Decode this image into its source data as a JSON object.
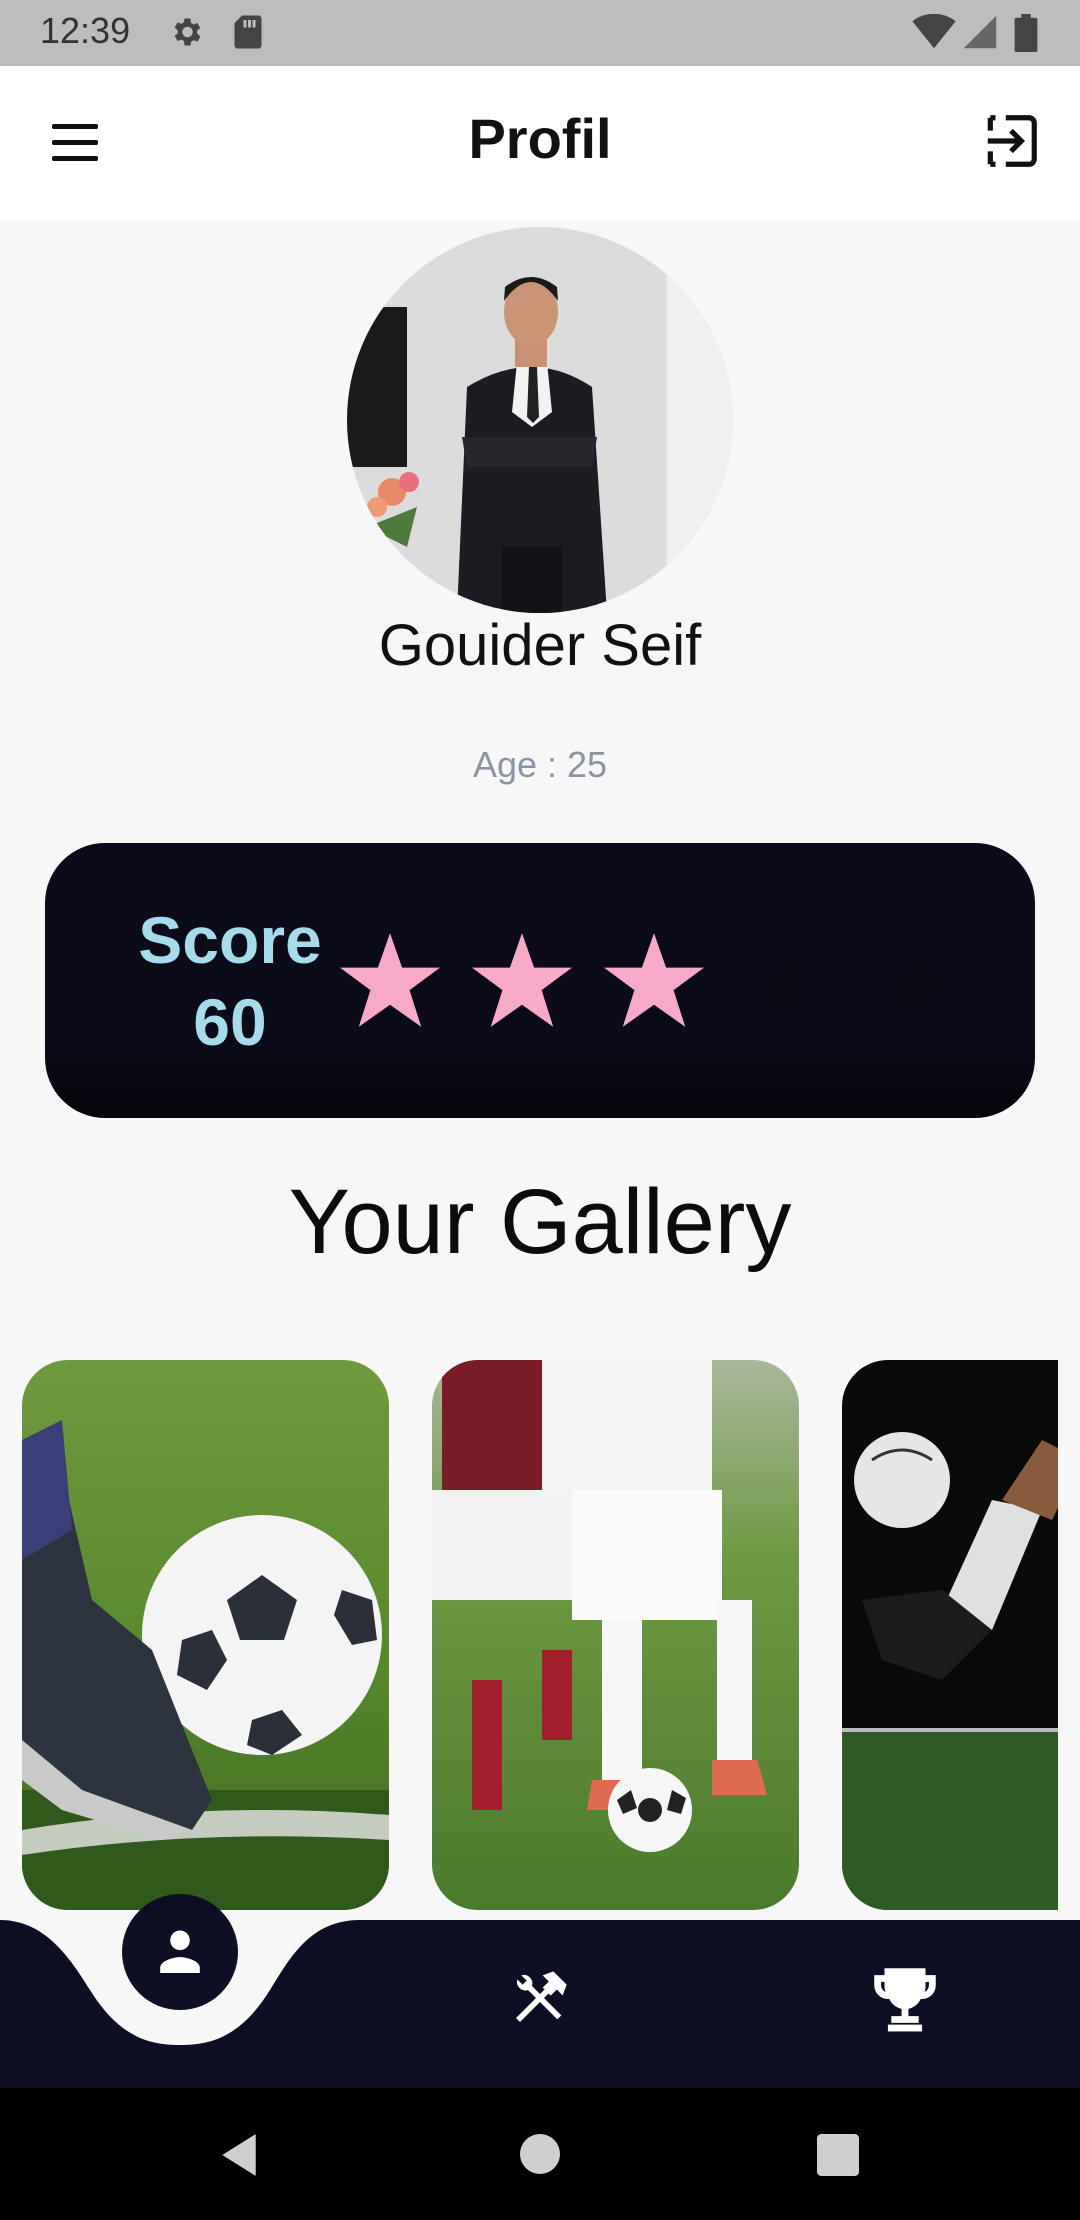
{
  "status_bar": {
    "time": "12:39",
    "icons": [
      "gear-icon",
      "sd-card-icon",
      "wifi-icon",
      "signal-icon",
      "battery-icon"
    ]
  },
  "app_bar": {
    "title": "Profil",
    "left_icon": "menu-icon",
    "right_icon": "logout-icon"
  },
  "profile": {
    "name": "Gouider Seif",
    "age_text": "Age : 25"
  },
  "score": {
    "label": "Score",
    "value": "60",
    "stars_filled": 3,
    "stars_total": 5,
    "filled_color": "#f6a9c8",
    "empty_color": "#0b0a16",
    "label_color": "#a6dbeb"
  },
  "gallery": {
    "title": "Your Gallery",
    "items": [
      {
        "subject": "boot and soccer ball on grass"
      },
      {
        "subject": "players dribbling soccer ball"
      },
      {
        "subject": "leg kicking ball on dark background"
      }
    ]
  },
  "bottom_nav": {
    "items": [
      {
        "icon": "person-icon",
        "active": true
      },
      {
        "icon": "tools-icon",
        "active": false
      },
      {
        "icon": "trophy-icon",
        "active": false
      }
    ],
    "background": "#0e0e24"
  },
  "system_nav": {
    "buttons": [
      "back-icon",
      "home-icon",
      "recents-icon"
    ]
  }
}
